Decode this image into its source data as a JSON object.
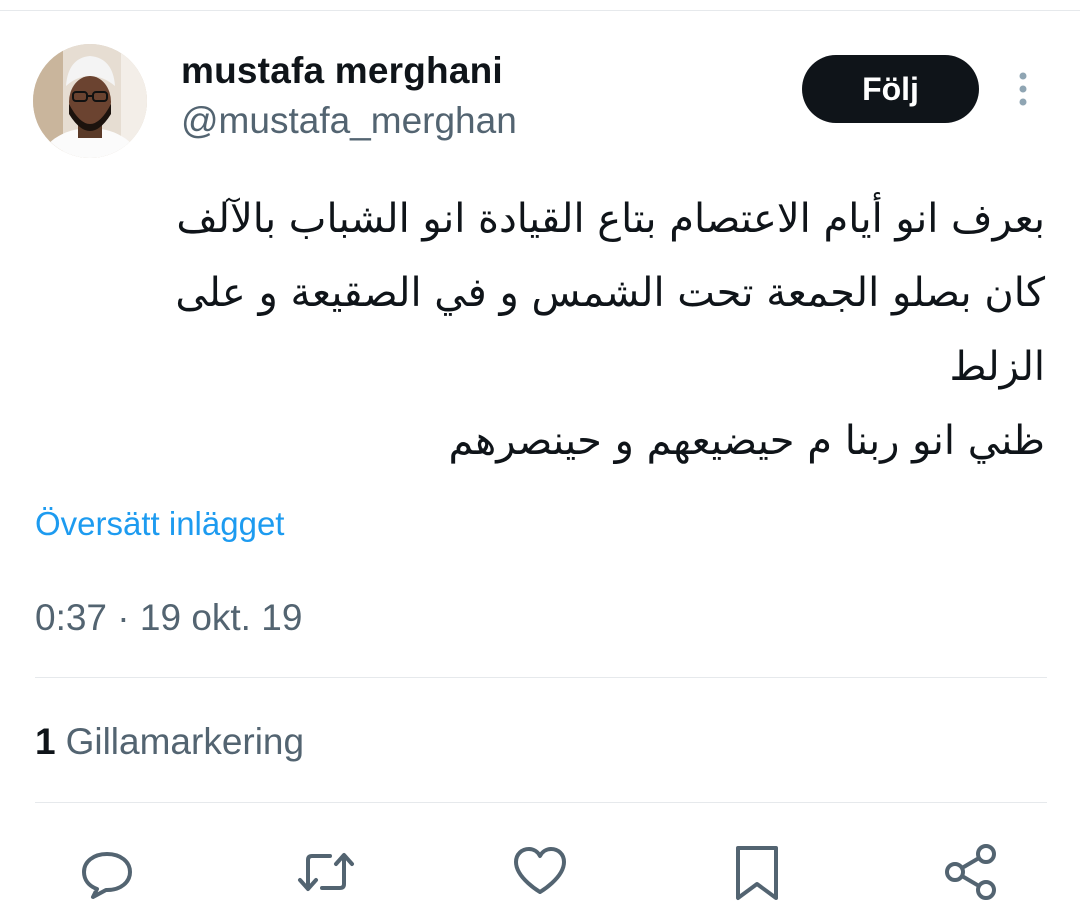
{
  "author": {
    "display_name": "mustafa merghani",
    "handle": "@mustafa_merghan"
  },
  "follow_label": "Följ",
  "tweet": {
    "lines": [
      "بعرف انو أيام الاعتصام بتاع القيادة انو الشباب بالآلف",
      "كان بصلو الجمعة تحت الشمس و في الصقيعة و على",
      "الزلط",
      "ظني انو ربنا م حيضيعهم و حينصرهم"
    ]
  },
  "translate_label": "Översätt inlägget",
  "timestamp": "0:37 · 19 okt. 19",
  "likes": {
    "count": "1",
    "label": "Gillamarkering"
  },
  "icons": {
    "more": "more-vertical-icon",
    "reply": "reply-icon",
    "repost": "repost-icon",
    "like": "heart-icon",
    "bookmark": "bookmark-icon",
    "share": "share-icon"
  },
  "colors": {
    "accent": "#1d9bf0",
    "text": "#0f1419",
    "secondary": "#536471",
    "button": "#0f1419",
    "divider": "#e6e9ec"
  }
}
